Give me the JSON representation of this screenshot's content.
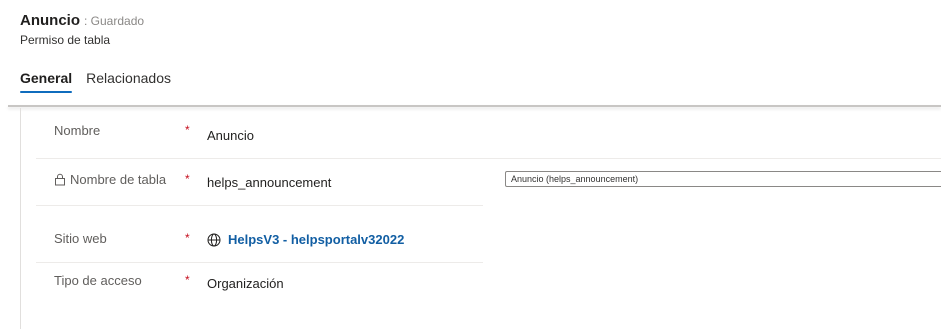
{
  "header": {
    "title": "Anuncio",
    "status": ": Guardado",
    "subtitle": "Permiso de tabla"
  },
  "tabs": [
    {
      "label": "General",
      "active": true
    },
    {
      "label": "Relacionados",
      "active": false
    }
  ],
  "form": {
    "nombre": {
      "label": "Nombre",
      "required": "*",
      "value": "Anuncio"
    },
    "nombre_tabla": {
      "label": "Nombre de tabla",
      "required": "*",
      "value": "helps_announcement",
      "icon": "lock-icon"
    },
    "tabla_select": {
      "value": "Anuncio (helps_announcement)",
      "icon": "chevron-down-icon"
    },
    "sitio_web": {
      "label": "Sitio web",
      "required": "*",
      "value": "HelpsV3 - helpsportalv32022",
      "icon": "globe-icon"
    },
    "tipo_acceso": {
      "label": "Tipo de acceso",
      "required": "*",
      "value": "Organización"
    }
  },
  "colors": {
    "accent": "#0f6cbd",
    "required": "#c50f1f",
    "link": "#115ea3"
  }
}
